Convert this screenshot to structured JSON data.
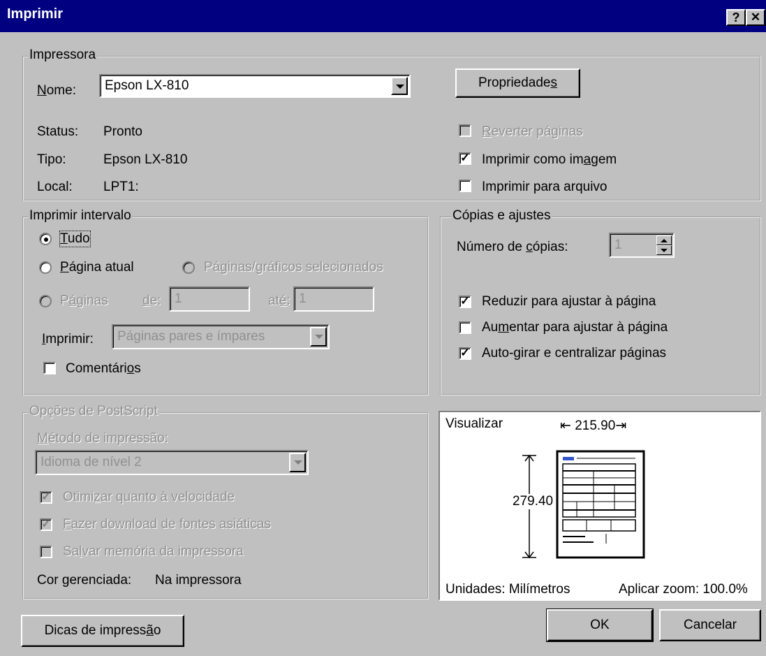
{
  "window": {
    "title": "Imprimir",
    "help_label": "?",
    "close_label": "✕"
  },
  "printer": {
    "group_label": "Impressora",
    "name_label": "Nome:",
    "name_value": "Epson LX-810",
    "properties_button": "Propriedades",
    "status_label": "Status:",
    "status_value": "Pronto",
    "type_label": "Tipo:",
    "type_value": "Epson LX-810",
    "location_label": "Local:",
    "location_value": "LPT1:",
    "reverse_pages": {
      "label": "Reverter páginas",
      "checked": false,
      "disabled": true
    },
    "print_as_image": {
      "label": "Imprimir como imagem",
      "checked": true
    },
    "print_to_file": {
      "label": "Imprimir para arquivo",
      "checked": false
    }
  },
  "range": {
    "group_label": "Imprimir intervalo",
    "all": "Tudo",
    "current_page": "Página atual",
    "selected": "Páginas/gráficos selecionados",
    "pages": "Páginas",
    "from_label": "de:",
    "from_value": "1",
    "to_label": "até:",
    "to_value": "1",
    "print_label": "Imprimir:",
    "print_value": "Páginas pares e ímpares",
    "comments": {
      "label": "Comentários",
      "checked": false
    },
    "selected_option": "all"
  },
  "copies": {
    "group_label": "Cópias e ajustes",
    "count_label": "Número de cópias:",
    "count_value": "1",
    "shrink": {
      "label": "Reduzir para ajustar à página",
      "checked": true
    },
    "enlarge": {
      "label": "Aumentar para ajustar à página",
      "checked": false
    },
    "autorotate": {
      "label": "Auto-girar e centralizar páginas",
      "checked": true
    }
  },
  "postscript": {
    "group_label": "Opções de PostScript",
    "method_label": "Método de impressão:",
    "method_value": "Idioma de nível 2",
    "optimize": {
      "label": "Otimizar quanto à velocidade",
      "checked": true
    },
    "download_fonts": {
      "label": "Fazer download de fontes asiáticas",
      "checked": true
    },
    "save_memory": {
      "label": "Salvar memória da impressora",
      "checked": false
    },
    "color_managed_label": "Cor gerenciada:",
    "color_managed_value": "Na impressora"
  },
  "preview": {
    "label": "Visualizar",
    "width_value": "215.90",
    "height_value": "279.40",
    "units": "Unidades: Milímetros",
    "zoom": "Aplicar zoom: 100.0%"
  },
  "buttons": {
    "tips": "Dicas de impressão",
    "ok": "OK",
    "cancel": "Cancelar"
  }
}
